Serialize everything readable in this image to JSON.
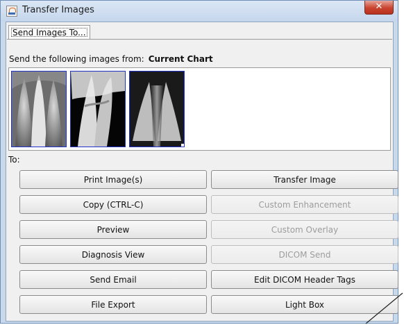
{
  "window": {
    "title": "Transfer Images",
    "app_icon": "java-cup-icon",
    "close_glyph": "✕"
  },
  "tab": {
    "label": "Send Images To..."
  },
  "source": {
    "prefix": "Send the following images from:",
    "name": "Current Chart"
  },
  "images": [
    {
      "name": "xray-image-1",
      "description": "dental x-ray thumbnail"
    },
    {
      "name": "xray-image-2",
      "description": "dental x-ray thumbnail"
    },
    {
      "name": "xray-image-3",
      "description": "dental x-ray thumbnail"
    }
  ],
  "to_label": "To:",
  "buttons": {
    "print": "Print Image(s)",
    "copy": "Copy (CTRL-C)",
    "preview": "Preview",
    "diagnosis": "Diagnosis View",
    "email": "Send Email",
    "export": "File Export",
    "transfer": "Transfer Image",
    "custom_enhancement": "Custom Enhancement",
    "custom_overlay": "Custom Overlay",
    "dicom_send": "DICOM Send",
    "edit_dicom": "Edit DICOM Header Tags",
    "light_box": "Light Box"
  },
  "colors": {
    "title_bar": "#c9d9ec",
    "close_button": "#c9442f",
    "thumb_border": "#2232c8",
    "disabled_text": "#9c9c9c"
  }
}
